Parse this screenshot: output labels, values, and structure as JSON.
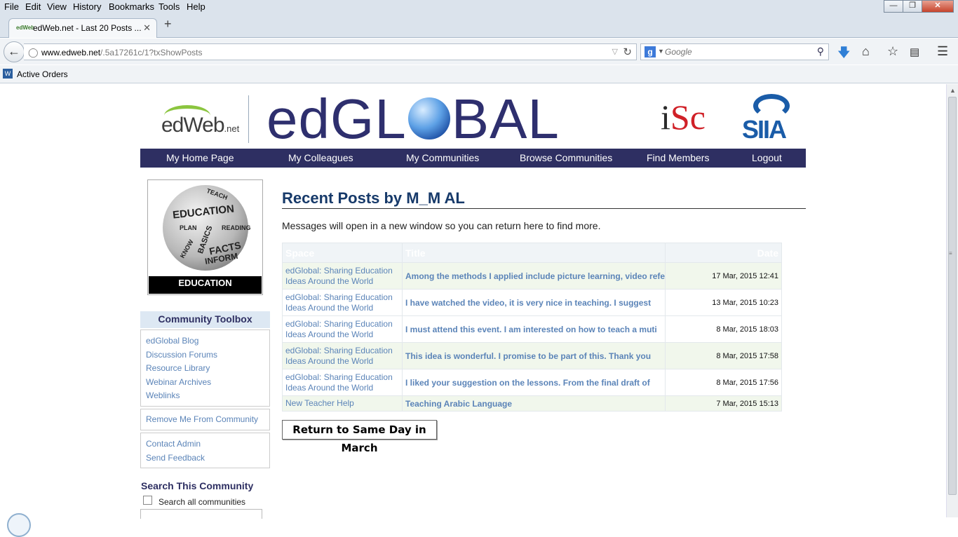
{
  "browser": {
    "menu": [
      {
        "label": "File"
      },
      {
        "label": "Edit"
      },
      {
        "label": "View"
      },
      {
        "label": "History"
      },
      {
        "label": "Bookmarks"
      },
      {
        "label": "Tools"
      },
      {
        "label": "Help"
      }
    ],
    "tab": {
      "favicon": "edWeb",
      "title": "edWeb.net - Last 20 Posts ..."
    },
    "url": {
      "host": "www.edweb.net",
      "path": "/.5a17261c/1?txShowPosts"
    },
    "search": {
      "engine_icon": "google-g-icon",
      "placeholder": "Google"
    },
    "bookmarks": [
      {
        "label": "Active Orders"
      }
    ]
  },
  "header": {
    "edweb_logo": "edWeb",
    "edweb_logo_suffix": ".net",
    "edglobal_logo_left": "edGL",
    "edglobal_logo_right": "BAL",
    "isc_logo_i": "i",
    "isc_logo_s": "S",
    "isc_logo_c": "c",
    "siia_logo": "SIIA"
  },
  "nav": [
    {
      "label": "My Home Page"
    },
    {
      "label": "My Colleagues"
    },
    {
      "label": "My Communities"
    },
    {
      "label": "Browse Communities"
    },
    {
      "label": "Find Members"
    },
    {
      "label": "Logout"
    }
  ],
  "sidebar": {
    "profile_image_words": [
      "EDUCATION",
      "FACTS",
      "INFORM",
      "BASICS",
      "READING",
      "PLAN",
      "KNOW",
      "TEACH"
    ],
    "profile_caption": "EDUCATION",
    "toolbox_title": "Community Toolbox",
    "toolbox_links": [
      {
        "label": "edGlobal Blog"
      },
      {
        "label": "Discussion Forums"
      },
      {
        "label": "Resource Library"
      },
      {
        "label": "Webinar Archives"
      },
      {
        "label": "Weblinks"
      }
    ],
    "remove_link": "Remove Me From Community",
    "contact_links": [
      {
        "label": "Contact Admin"
      },
      {
        "label": "Send Feedback"
      }
    ],
    "search_title": "Search This Community",
    "search_all_label": "Search all communities"
  },
  "main": {
    "title": "Recent Posts by M_M AL",
    "note": "Messages will open in a new window so you can return here to find more.",
    "columns": {
      "space": "Space",
      "title": "Title",
      "date": "Date"
    },
    "posts": [
      {
        "space": "edGlobal: Sharing Education Ideas Around the World",
        "title": "Among the methods I applied include picture learning, video refe",
        "date": "17 Mar, 2015 12:41"
      },
      {
        "space": "edGlobal: Sharing Education Ideas Around the World",
        "title": "I have watched the video, it is very nice in teaching. I suggest",
        "date": "13 Mar, 2015 10:23"
      },
      {
        "space": "edGlobal: Sharing Education Ideas Around the World",
        "title": "I must attend this event. I am interested on how to teach a muti",
        "date": "8 Mar, 2015 18:03"
      },
      {
        "space": "edGlobal: Sharing Education Ideas Around the World",
        "title": "This idea is wonderful. I promise to be part of this. Thank you",
        "date": "8 Mar, 2015 17:58"
      },
      {
        "space": "edGlobal: Sharing Education Ideas Around the World",
        "title": "I liked your suggestion on the lessons. From the final draft of",
        "date": "8 Mar, 2015 17:56"
      },
      {
        "space": "New Teacher Help",
        "title": "Teaching Arabic Language",
        "date": "7 Mar, 2015 15:13"
      }
    ],
    "return_button": "Return to Same Day in March"
  }
}
